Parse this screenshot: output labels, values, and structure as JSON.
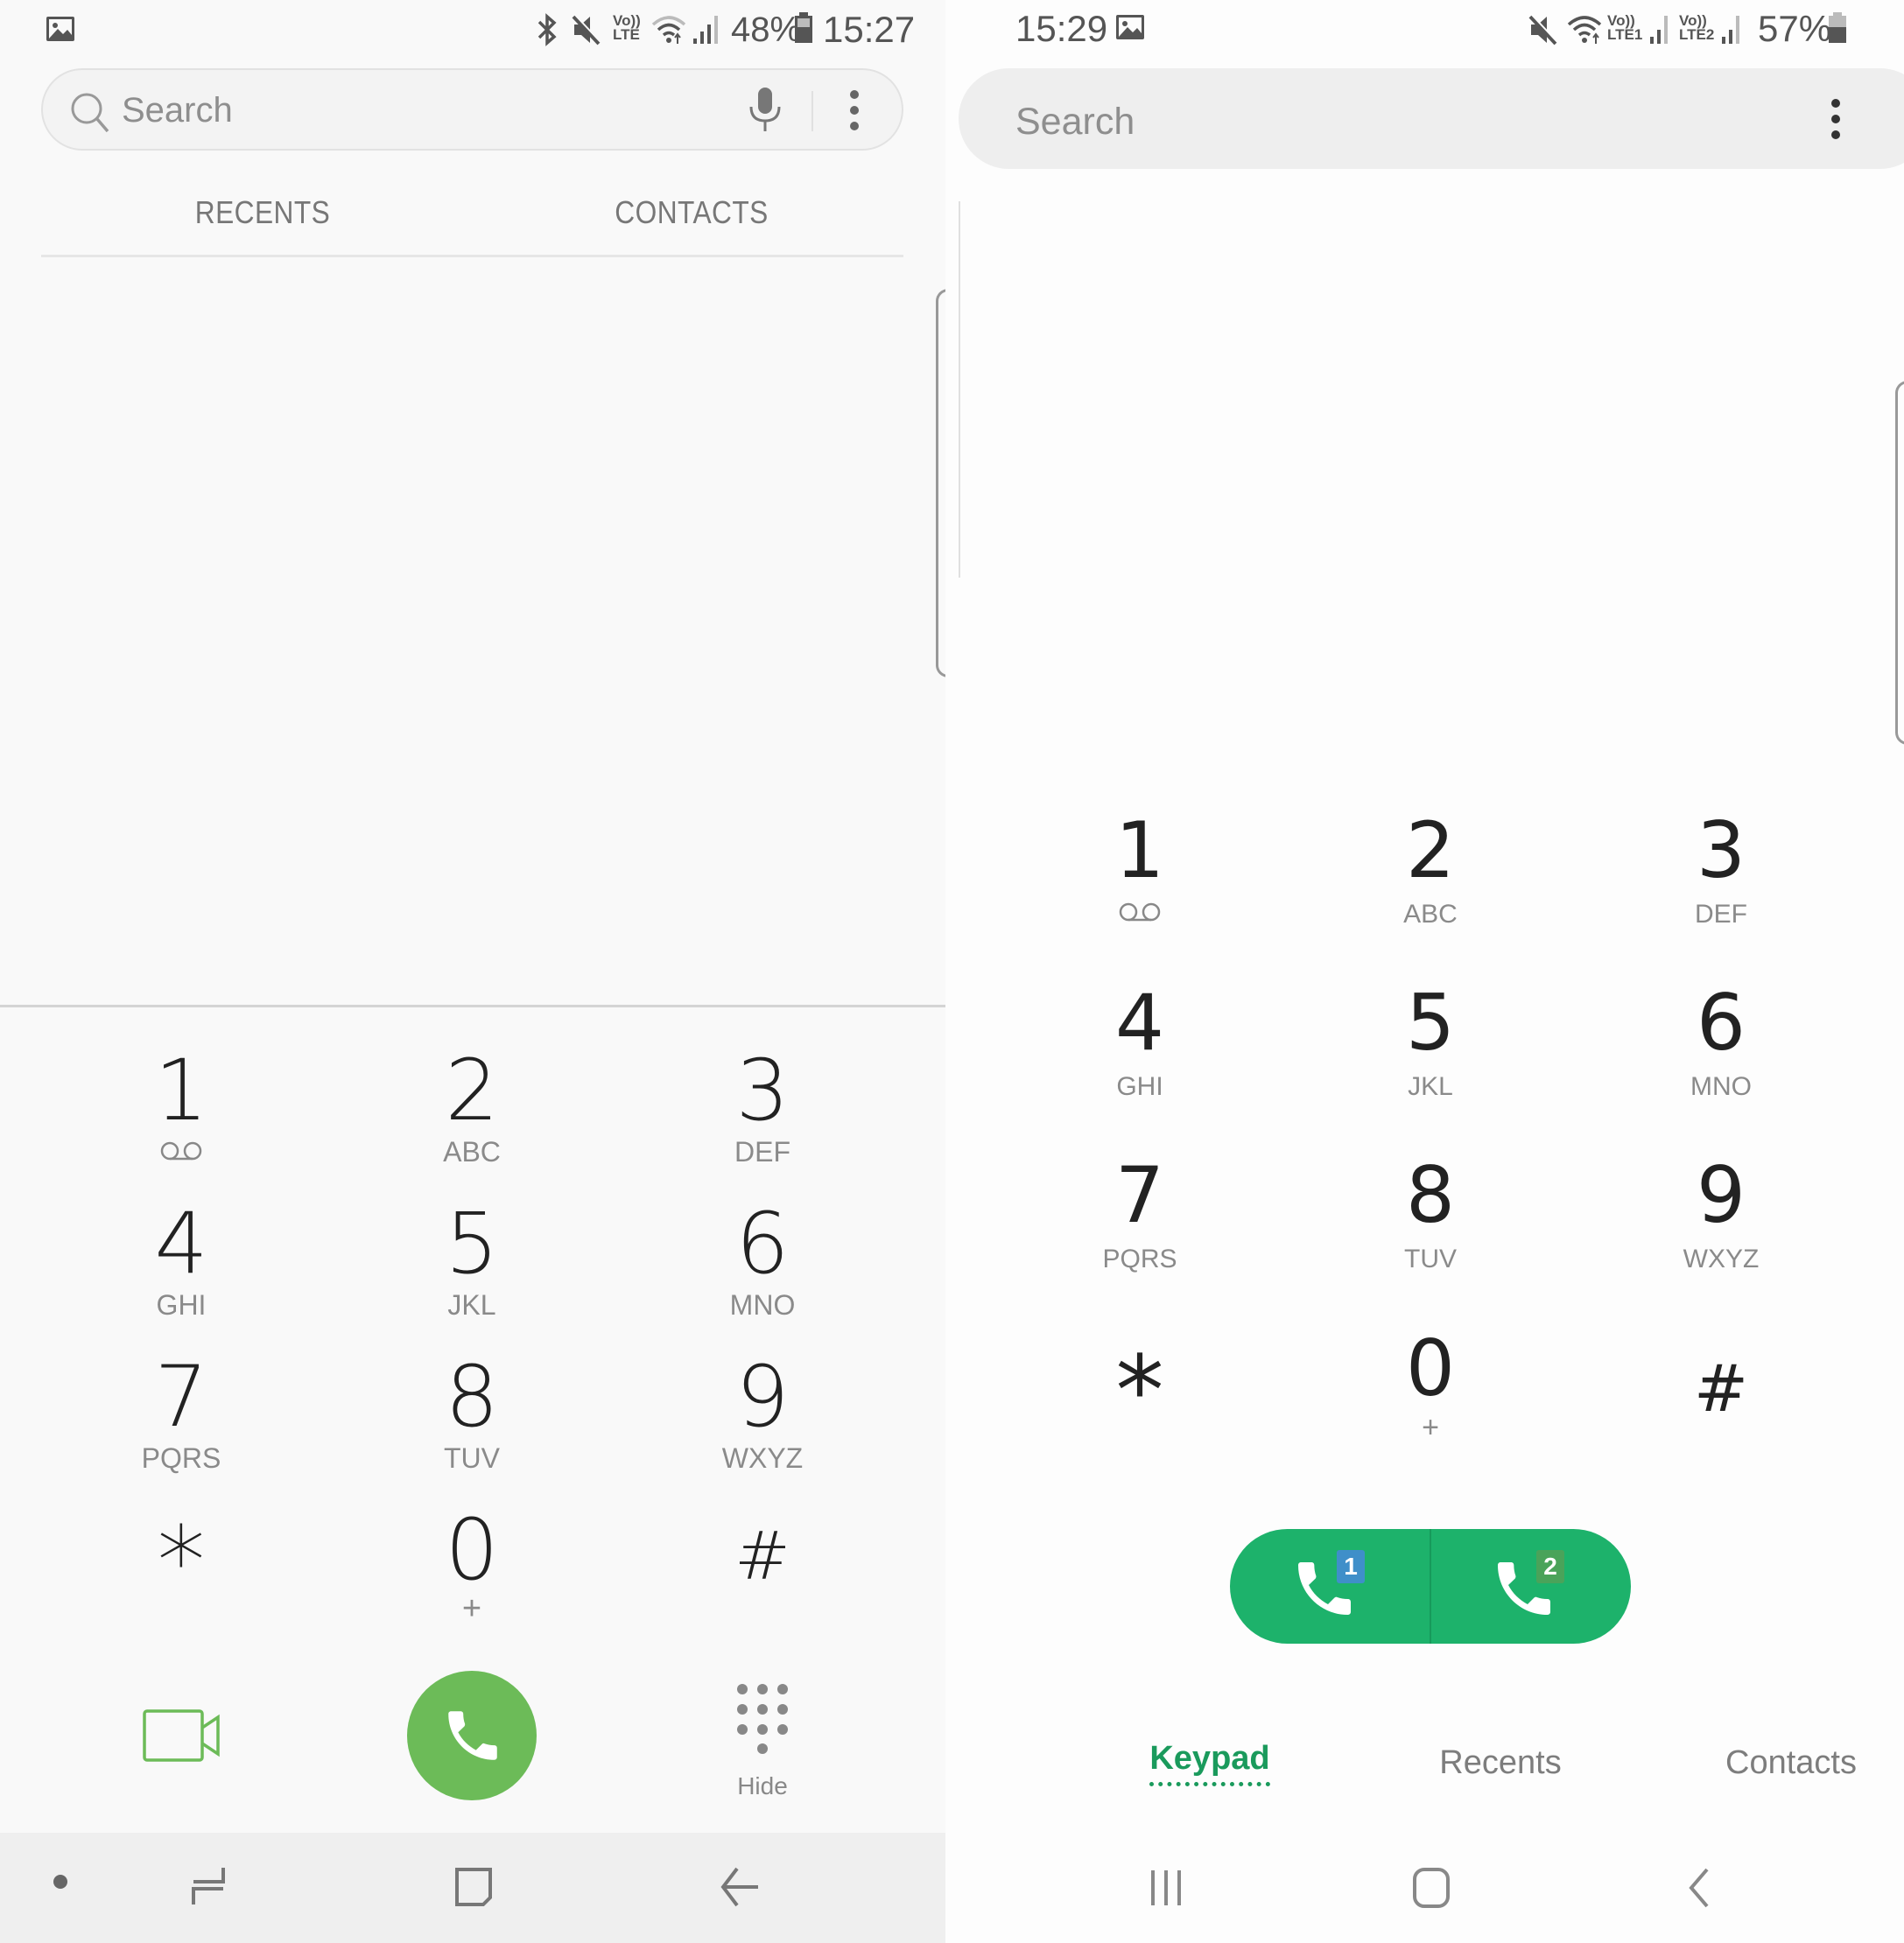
{
  "left_screen": {
    "status_bar": {
      "notification_icon": "gallery-image-icon",
      "icons": [
        "bluetooth-icon",
        "mute-icon",
        "volte-icon",
        "wifi-icon",
        "signal-icon"
      ],
      "volte_label_top": "Vo))",
      "volte_label_bottom": "LTE",
      "battery_percent": "48%",
      "time": "15:27"
    },
    "search": {
      "placeholder": "Search",
      "mic_icon": "microphone-icon",
      "more_icon": "more-vertical-icon"
    },
    "tabs": [
      {
        "label": "RECENTS"
      },
      {
        "label": "CONTACTS"
      }
    ],
    "keypad": [
      {
        "digit": "1",
        "sub": "voicemail"
      },
      {
        "digit": "2",
        "sub": "ABC"
      },
      {
        "digit": "3",
        "sub": "DEF"
      },
      {
        "digit": "4",
        "sub": "GHI"
      },
      {
        "digit": "5",
        "sub": "JKL"
      },
      {
        "digit": "6",
        "sub": "MNO"
      },
      {
        "digit": "7",
        "sub": "PQRS"
      },
      {
        "digit": "8",
        "sub": "TUV"
      },
      {
        "digit": "9",
        "sub": "WXYZ"
      },
      {
        "digit": "*",
        "sub": ""
      },
      {
        "digit": "0",
        "sub": "+"
      },
      {
        "digit": "#",
        "sub": ""
      }
    ],
    "actions": {
      "video_call_icon": "video-camera-icon",
      "call_icon": "phone-icon",
      "hide_label": "Hide",
      "call_color": "#6cbb58"
    },
    "nav_bar": [
      "dot",
      "recents",
      "home",
      "back"
    ]
  },
  "right_screen": {
    "status_bar": {
      "time": "15:29",
      "notification_icon": "gallery-image-icon",
      "sim1_label_top": "Vo))",
      "sim1_label_bottom": "LTE1",
      "sim2_label_top": "Vo))",
      "sim2_label_bottom": "LTE2",
      "battery_percent": "57%"
    },
    "search": {
      "placeholder": "Search",
      "more_icon": "more-vertical-icon"
    },
    "keypad": [
      {
        "digit": "1",
        "sub": "voicemail"
      },
      {
        "digit": "2",
        "sub": "ABC"
      },
      {
        "digit": "3",
        "sub": "DEF"
      },
      {
        "digit": "4",
        "sub": "GHI"
      },
      {
        "digit": "5",
        "sub": "JKL"
      },
      {
        "digit": "6",
        "sub": "MNO"
      },
      {
        "digit": "7",
        "sub": "PQRS"
      },
      {
        "digit": "8",
        "sub": "TUV"
      },
      {
        "digit": "9",
        "sub": "WXYZ"
      },
      {
        "digit": "*",
        "sub": ""
      },
      {
        "digit": "0",
        "sub": "+"
      },
      {
        "digit": "#",
        "sub": ""
      }
    ],
    "call_buttons": [
      {
        "sim": "1",
        "badge_color": "#3f8fc9"
      },
      {
        "sim": "2",
        "badge_color": "#4aa35a"
      }
    ],
    "call_color": "#1db26b",
    "bottom_tabs": [
      {
        "label": "Keypad",
        "active": true
      },
      {
        "label": "Recents",
        "active": false
      },
      {
        "label": "Contacts",
        "active": false
      }
    ],
    "active_color": "#1a9a5c",
    "nav_bar": [
      "recents",
      "home",
      "back"
    ]
  }
}
